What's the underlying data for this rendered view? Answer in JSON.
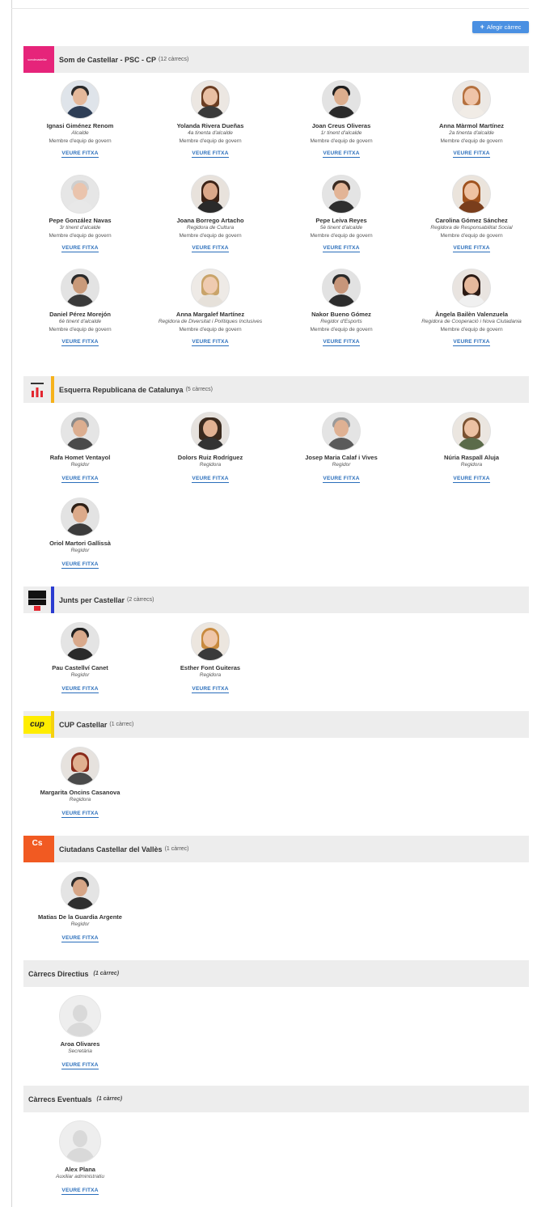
{
  "add_button_label": "Afegir càrrec",
  "link_label": "VEURE FITXA",
  "member_note": "Membre d'equip de govern",
  "groups": [
    {
      "name": "Som de Castellar - PSC - CP",
      "count": "(12 càrrecs)",
      "logo_icon": "psc-logo-icon",
      "logo_text": "somdecastellar",
      "bar_color": "#e6247a",
      "people": [
        {
          "name": "Ignasi Giménez Renom",
          "role": "Alcalde",
          "member": "Membre d'equip de govern"
        },
        {
          "name": "Yolanda Rivera Dueñas",
          "role": "4a tinenta d'alcalde",
          "member": "Membre d'equip de govern"
        },
        {
          "name": "Joan Creus Oliveras",
          "role": "1r tinent d'alcalde",
          "member": "Membre d'equip de govern"
        },
        {
          "name": "Anna Màrmol Martínez",
          "role": "2a tinenta d'alcalde",
          "member": "Membre d'equip de govern"
        },
        {
          "name": "Pepe González Navas",
          "role": "3r tinent d'alcalde",
          "member": "Membre d'equip de govern"
        },
        {
          "name": "Joana Borrego Artacho",
          "role": "Regidora de Cultura",
          "member": "Membre d'equip de govern"
        },
        {
          "name": "Pepe Leiva Reyes",
          "role": "5è tinent d'alcalde",
          "member": "Membre d'equip de govern"
        },
        {
          "name": "Carolina Gómez Sánchez",
          "role": "Regidora de Responsabilitat Social",
          "member": "Membre d'equip de govern"
        },
        {
          "name": "Daniel Pérez Morejón",
          "role": "6è tinent d'alcalde",
          "member": "Membre d'equip de govern"
        },
        {
          "name": "Anna Margalef Martínez",
          "role": "Regidora de Diversitat i Polítiques Inclusives",
          "member": "Membre d'equip de govern"
        },
        {
          "name": "Nakor Bueno Gómez",
          "role": "Regidor d'Esports",
          "member": "Membre d'equip de govern"
        },
        {
          "name": "Àngela Bailèn Valenzuela",
          "role": "Regidora de Cooperació i Nova Ciutadania",
          "member": "Membre d'equip de govern"
        }
      ]
    },
    {
      "name": "Esquerra Republicana de Catalunya",
      "count": "(5 càrrecs)",
      "logo_icon": "erc-logo-icon",
      "bar_color": "#f6b21b",
      "people": [
        {
          "name": "Rafa Homet Ventayol",
          "role": "Regidor"
        },
        {
          "name": "Dolors Ruiz Rodríguez",
          "role": "Regidora"
        },
        {
          "name": "Josep Maria Calaf i Vives",
          "role": "Regidor"
        },
        {
          "name": "Núria Raspall Aluja",
          "role": "Regidora"
        },
        {
          "name": "Oriol Martori Gallissà",
          "role": "Regidor"
        }
      ]
    },
    {
      "name": "Junts per Castellar",
      "count": "(2 càrrecs)",
      "logo_icon": "junts-logo-icon",
      "logo_text": "JUNTS CASTELLAR",
      "bar_color": "#2a3bd1",
      "people": [
        {
          "name": "Pau Castellví Canet",
          "role": "Regidor"
        },
        {
          "name": "Esther Font Guiteras",
          "role": "Regidora"
        }
      ]
    },
    {
      "name": "CUP Castellar",
      "count": "(1 càrrec)",
      "logo_icon": "cup-logo-icon",
      "logo_text": "cup",
      "bar_color": "#f5d10f",
      "people": [
        {
          "name": "Margarita Oncins Casanova",
          "role": "Regidora"
        }
      ]
    },
    {
      "name": "Ciutadans Castellar del Vallès",
      "count": "(1 càrrec)",
      "logo_icon": "cs-logo-icon",
      "logo_text": "Cs",
      "bar_color": "#f15a22",
      "people": [
        {
          "name": "Matias De la Guardia Argente",
          "role": "Regidor"
        }
      ]
    },
    {
      "name": "Càrrecs Directius",
      "count": "(1 càrrec)",
      "people": [
        {
          "name": "Aroa Olivares",
          "role": "Secretària"
        }
      ]
    },
    {
      "name": "Càrrecs Eventuals",
      "count": "(1 càrrec)",
      "people": [
        {
          "name": "Alex Plana",
          "role": "Auxiliar administratiu"
        }
      ]
    }
  ]
}
